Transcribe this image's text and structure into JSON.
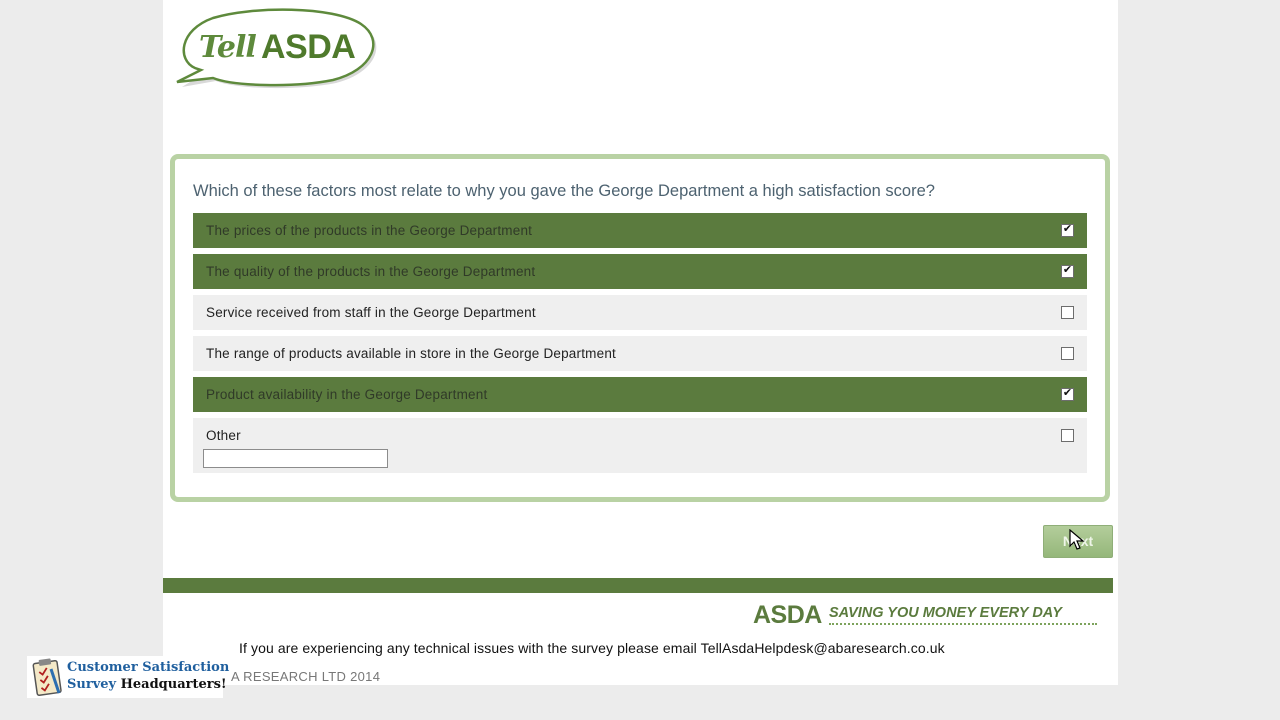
{
  "logo": {
    "tell": "Tell",
    "asda": "ASDA"
  },
  "question": {
    "text": "Which of these factors most relate to why you gave the George Department a high satisfaction score?",
    "options": [
      {
        "label": "The prices of the products in the George Department",
        "checked": true
      },
      {
        "label": "The quality of the products in the George Department",
        "checked": true
      },
      {
        "label": "Service received from staff in the George Department",
        "checked": false
      },
      {
        "label": "The range of products available in store in the George Department",
        "checked": false
      },
      {
        "label": "Product availability in the George Department",
        "checked": true
      },
      {
        "label": "Other",
        "checked": false
      }
    ],
    "other_value": ""
  },
  "next_label": "Next",
  "footer": {
    "brand": "ASDA",
    "slogan": "SAVING YOU MONEY EVERY DAY",
    "support": "If you are experiencing any technical issues with the survey please email TellAsdaHelpdesk@abaresearch.co.uk",
    "copyright": "A RESEARCH LTD 2014"
  },
  "watermark": {
    "line1": "Customer Satisfaction",
    "line2a": "Survey ",
    "line2b": "Headquarters!"
  },
  "colors": {
    "brand_green": "#5b7b3e",
    "card_border": "#b9d2a4",
    "option_bg": "#efefef"
  }
}
